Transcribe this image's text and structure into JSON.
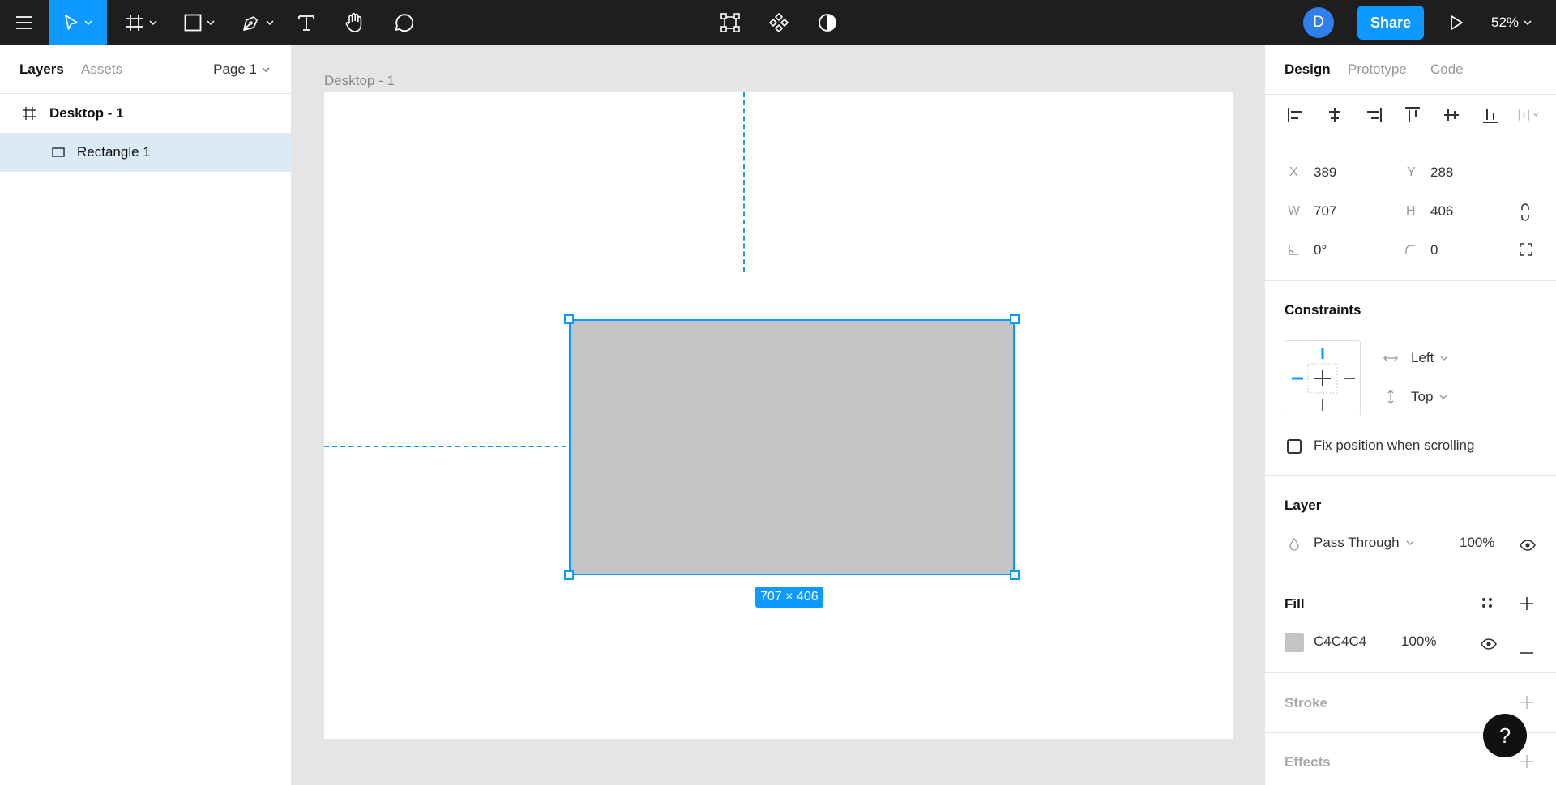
{
  "toolbar": {
    "icons": [
      "menu-icon",
      "move-tool-icon",
      "frame-tool-icon",
      "shape-tool-icon",
      "pen-tool-icon",
      "text-tool-icon",
      "hand-tool-icon",
      "comment-tool-icon",
      "component-icon",
      "instance-icon",
      "contrast-icon",
      "play-icon"
    ],
    "avatar_initial": "D",
    "share_label": "Share",
    "zoom": "52%"
  },
  "left_panel": {
    "tabs": [
      {
        "label": "Layers",
        "active": true
      },
      {
        "label": "Assets",
        "active": false
      }
    ],
    "page_selector": "Page 1",
    "layers": [
      {
        "name": "Desktop - 1",
        "type": "frame",
        "selected": false
      },
      {
        "name": "Rectangle 1",
        "type": "rectangle",
        "selected": true
      }
    ]
  },
  "canvas": {
    "frame_label": "Desktop - 1",
    "selection_dims": "707 × 406"
  },
  "right_panel": {
    "tabs": [
      {
        "label": "Design",
        "active": true
      },
      {
        "label": "Prototype",
        "active": false
      },
      {
        "label": "Code",
        "active": false
      }
    ],
    "geometry": {
      "x_label": "X",
      "x": "389",
      "y_label": "Y",
      "y": "288",
      "w_label": "W",
      "w": "707",
      "h_label": "H",
      "h": "406",
      "rotation": "0°",
      "radius": "0"
    },
    "constraints": {
      "title": "Constraints",
      "horizontal": "Left",
      "vertical": "Top",
      "fix_position_label": "Fix position when scrolling"
    },
    "layer": {
      "title": "Layer",
      "blend_mode": "Pass Through",
      "opacity": "100%"
    },
    "fill": {
      "title": "Fill",
      "color_hex": "C4C4C4",
      "swatch_color": "#c4c4c4",
      "opacity": "100%"
    },
    "stroke": {
      "title": "Stroke"
    },
    "effects": {
      "title": "Effects"
    }
  },
  "help_label": "?",
  "colors": {
    "accent": "#0d99ff",
    "toolbar_bg": "#1e1e1e",
    "selection_bg": "#daebf7"
  }
}
